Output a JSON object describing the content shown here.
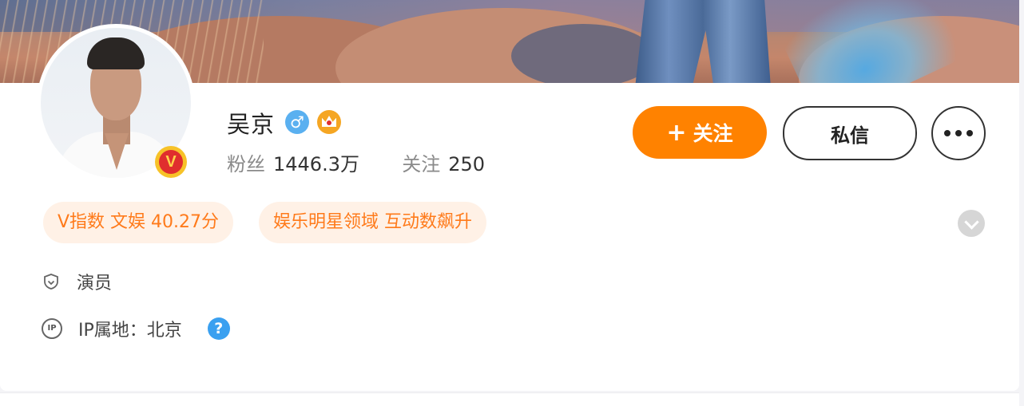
{
  "profile": {
    "name": "吴京",
    "gender_icon": "male",
    "badge": "V",
    "stats": {
      "fans_label": "粉丝",
      "fans_value": "1446.3万",
      "follow_label": "关注",
      "follow_value": "250"
    }
  },
  "actions": {
    "follow_plus": "+",
    "follow_label": "关注",
    "message_label": "私信"
  },
  "tags": [
    "V指数 文娱 40.27分",
    "娱乐明星领域 互动数飙升"
  ],
  "info": {
    "occupation": "演员",
    "ip_icon": "IP",
    "ip_location": "IP属地：北京",
    "help_icon": "?"
  },
  "colors": {
    "accent": "#ff8200",
    "tag_bg": "#fff1e6",
    "tag_text": "#ff7a1a",
    "help_blue": "#3aa0f0"
  }
}
